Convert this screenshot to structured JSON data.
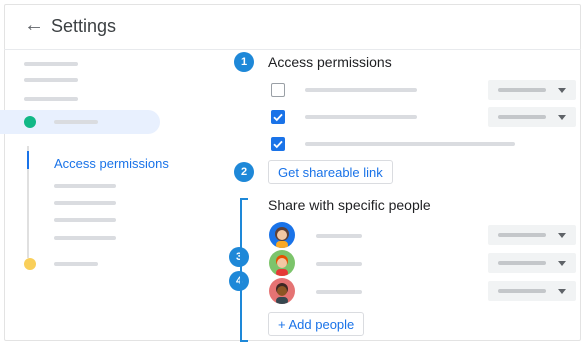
{
  "header": {
    "back_icon": "arrow-left-icon",
    "title": "Settings"
  },
  "sidebar": {
    "active_dot_color": "#12b886",
    "inactive_dot_color": "#f9cf5a",
    "sub_item_label": "Access permissions"
  },
  "steps": [
    "1",
    "2",
    "3",
    "4"
  ],
  "permissions": {
    "title": "Access permissions",
    "rows": [
      {
        "checked": false
      },
      {
        "checked": true
      },
      {
        "checked": true
      }
    ]
  },
  "share_link": {
    "label": "Get shareable link"
  },
  "people": {
    "title": "Share with specific people",
    "avatars": [
      {
        "icon": "person-avatar-icon",
        "color": "#1a73e8"
      },
      {
        "icon": "person-avatar-icon",
        "color": "#7cc46b"
      },
      {
        "icon": "person-avatar-icon",
        "color": "#e57373"
      }
    ],
    "add_label": "+ Add people"
  },
  "colors": {
    "accent": "#1a73e8",
    "step_badge": "#1e88d8"
  }
}
